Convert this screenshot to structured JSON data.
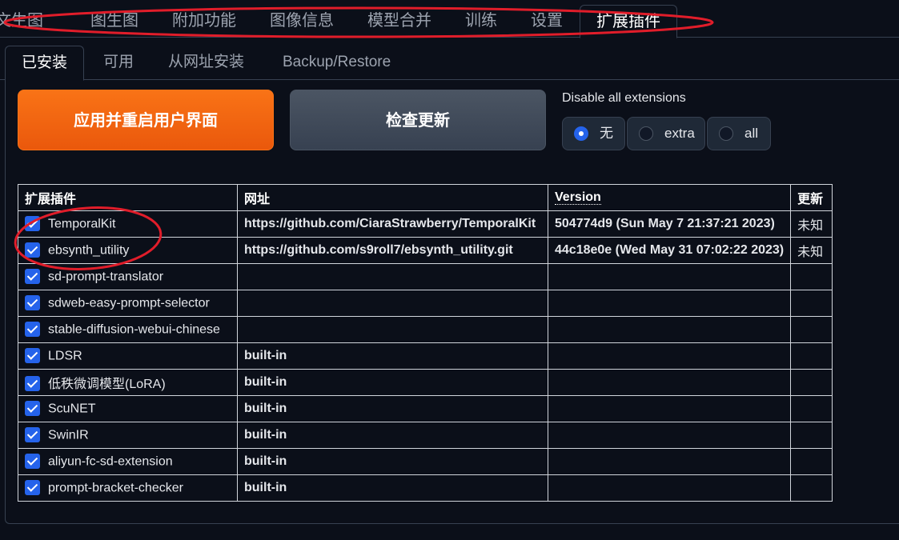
{
  "top_tabs": [
    "文生图",
    "图生图",
    "附加功能",
    "图像信息",
    "模型合并",
    "训练",
    "设置",
    "扩展插件"
  ],
  "active_top_tab": "扩展插件",
  "sub_tabs": [
    "已安装",
    "可用",
    "从网址安装",
    "Backup/Restore"
  ],
  "active_sub_tab": "已安装",
  "buttons": {
    "apply": "应用并重启用户界面",
    "check_updates": "检查更新"
  },
  "disable_all": {
    "label": "Disable all extensions",
    "options": [
      "无",
      "extra",
      "all"
    ],
    "selected": "无"
  },
  "table": {
    "headers": [
      "扩展插件",
      "网址",
      "Version",
      "更新"
    ],
    "rows": [
      {
        "name": "TemporalKit",
        "url": "https://github.com/CiaraStrawberry/TemporalKit",
        "version": "504774d9 (Sun May 7 21:37:21 2023)",
        "update": "未知",
        "checked": true
      },
      {
        "name": "ebsynth_utility",
        "url": "https://github.com/s9roll7/ebsynth_utility.git",
        "version": "44c18e0e (Wed May 31 07:02:22 2023)",
        "update": "未知",
        "checked": true
      },
      {
        "name": "sd-prompt-translator",
        "url": "",
        "version": "",
        "update": "",
        "checked": true
      },
      {
        "name": "sdweb-easy-prompt-selector",
        "url": "",
        "version": "",
        "update": "",
        "checked": true
      },
      {
        "name": "stable-diffusion-webui-chinese",
        "url": "",
        "version": "",
        "update": "",
        "checked": true
      },
      {
        "name": "LDSR",
        "url": "built-in",
        "version": "",
        "update": "",
        "checked": true
      },
      {
        "name": "低秩微调模型(LoRA)",
        "url": "built-in",
        "version": "",
        "update": "",
        "checked": true
      },
      {
        "name": "ScuNET",
        "url": "built-in",
        "version": "",
        "update": "",
        "checked": true
      },
      {
        "name": "SwinIR",
        "url": "built-in",
        "version": "",
        "update": "",
        "checked": true
      },
      {
        "name": "aliyun-fc-sd-extension",
        "url": "built-in",
        "version": "",
        "update": "",
        "checked": true
      },
      {
        "name": "prompt-bracket-checker",
        "url": "built-in",
        "version": "",
        "update": "",
        "checked": true
      }
    ]
  },
  "colors": {
    "accent": "#f97316",
    "checkbox": "#2563eb",
    "annotation": "#e11d2a",
    "background": "#0b0f19"
  }
}
